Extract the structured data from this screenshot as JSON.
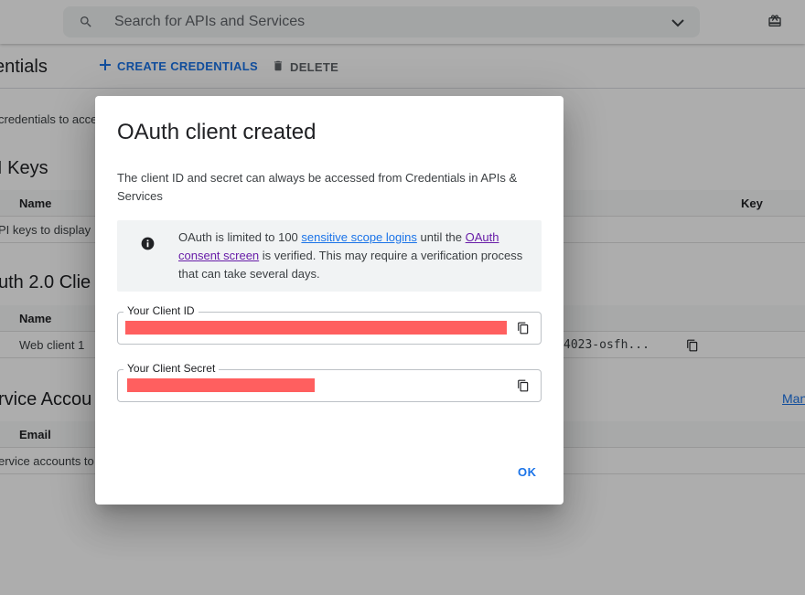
{
  "topbar": {
    "search_placeholder": "Search for APIs and Services"
  },
  "toolbar": {
    "page_title": "entials",
    "create_label": "CREATE CREDENTIALS",
    "delete_label": "DELETE"
  },
  "background": {
    "intro_text": "credentials to acce",
    "api_keys": {
      "section_title": "I Keys",
      "col_name": "Name",
      "col_key": "Key",
      "empty_text": "PI keys to display"
    },
    "oauth": {
      "section_title": "uth 2.0 Clie",
      "col_name": "Name",
      "row_name": "Web client 1",
      "row_client_id": "4023-osfh..."
    },
    "service_accounts": {
      "section_title": "rvice Accou",
      "col_email": "Email",
      "empty_text": "ervice accounts to",
      "manage_link": "Man"
    }
  },
  "dialog": {
    "title": "OAuth client created",
    "body": "The client ID and secret can always be accessed from Credentials in APIs & Services",
    "info": {
      "prefix": "OAuth is limited to 100 ",
      "link1": "sensitive scope logins",
      "middle": " until the ",
      "link2": "OAuth consent screen",
      "suffix": " is verified. This may require a verification process that can take several days."
    },
    "client_id_label": "Your Client ID",
    "client_secret_label": "Your Client Secret",
    "ok_label": "OK"
  },
  "colors": {
    "accent": "#1a73e8",
    "visited_link": "#681da8",
    "redaction": "#ff5f5f"
  }
}
